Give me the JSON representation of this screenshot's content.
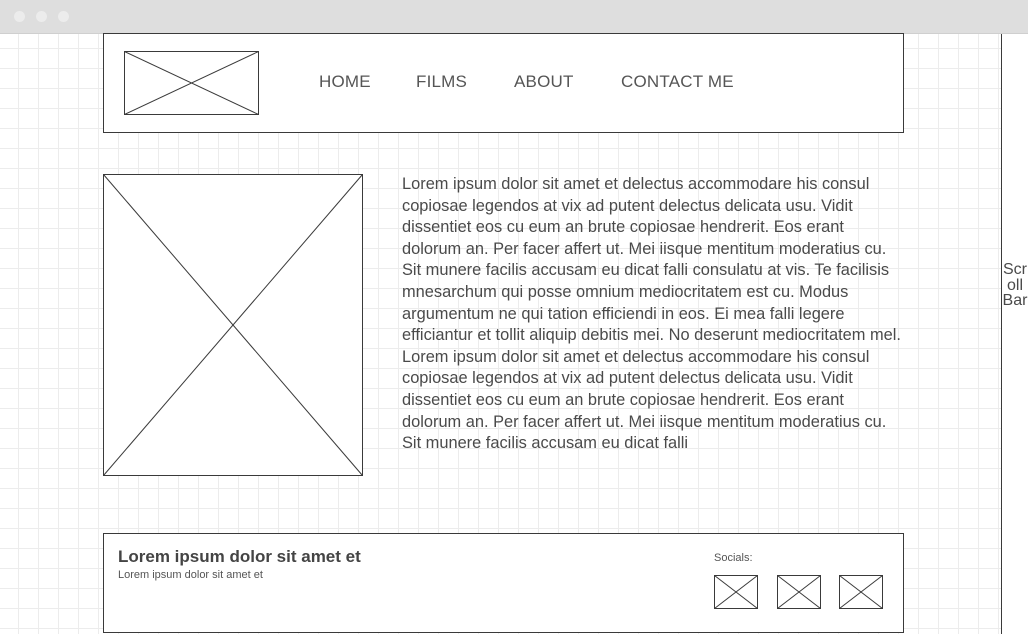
{
  "nav": {
    "items": [
      {
        "label": "HOME"
      },
      {
        "label": "FILMS"
      },
      {
        "label": "ABOUT"
      },
      {
        "label": "CONTACT ME"
      }
    ]
  },
  "main": {
    "paragraph": "Lorem ipsum dolor sit amet et delectus accommodare his consul copiosae legendos at vix ad putent delectus delicata usu. Vidit dissentiet eos cu eum an brute copiosae hendrerit. Eos erant dolorum an. Per facer affert ut. Mei iisque mentitum moderatius cu. Sit munere facilis accusam eu dicat falli consulatu at vis. Te facilisis mnesarchum qui posse omnium mediocritatem est cu. Modus argumentum ne qui tation efficiendi in eos. Ei mea falli legere efficiantur et tollit aliquip debitis mei. No deserunt mediocritatem mel. Lorem ipsum dolor sit amet et delectus accommodare his consul copiosae legendos at vix ad putent delectus delicata usu. Vidit dissentiet eos cu eum an brute copiosae hendrerit. Eos erant dolorum an. Per facer affert ut. Mei iisque mentitum moderatius cu. Sit munere facilis accusam eu dicat falli"
  },
  "footer": {
    "title": "Lorem ipsum dolor sit amet et",
    "subtitle": "Lorem ipsum dolor sit amet et",
    "socials_label": "Socials:"
  },
  "scrollbar": {
    "label": "ScrollBar"
  }
}
